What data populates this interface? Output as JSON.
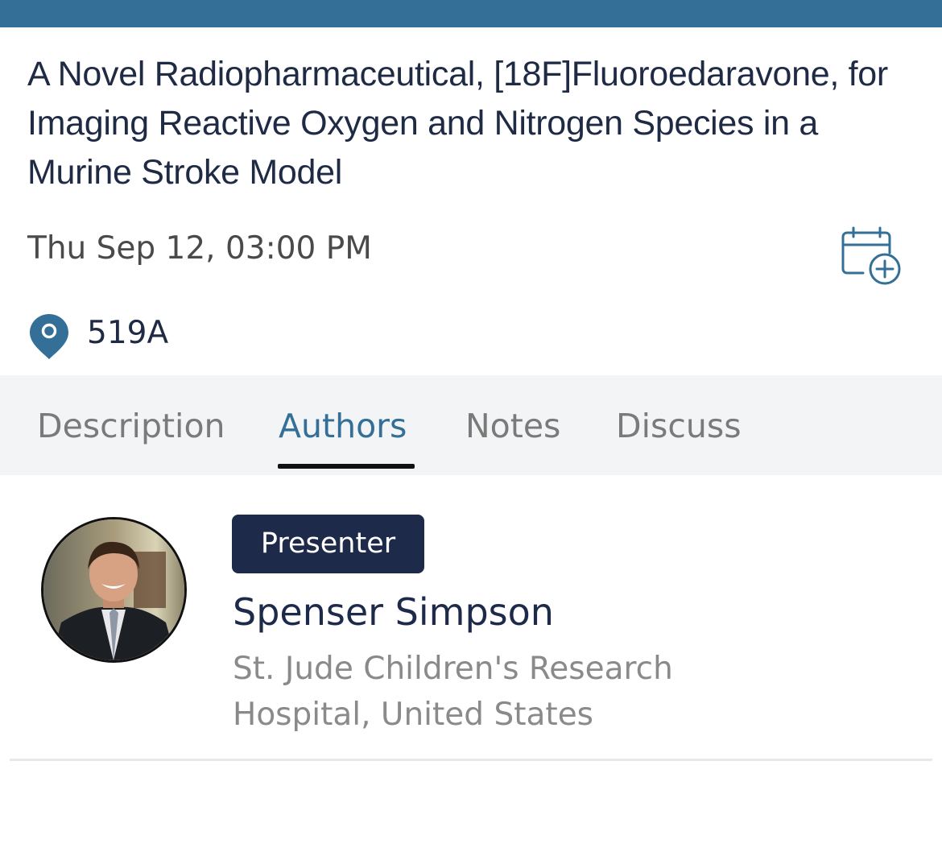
{
  "session": {
    "title": "A Novel Radiopharmaceutical, [18F]Fluoroedaravone, for Imaging Reactive Oxygen and Nitrogen Species in a Murine Stroke Model",
    "datetime": "Thu Sep 12, 03:00 PM",
    "location": "519A"
  },
  "icons": {
    "calendar": "calendar-add-icon",
    "location": "location-pin-icon"
  },
  "colors": {
    "top_bar": "#336f96",
    "accent": "#336f96",
    "badge_bg": "#1e2a4a",
    "tab_bar_bg": "#f3f4f5"
  },
  "tabs": [
    {
      "label": "Description",
      "active": false
    },
    {
      "label": "Authors",
      "active": true
    },
    {
      "label": "Notes",
      "active": false
    },
    {
      "label": "Discuss",
      "active": false
    }
  ],
  "authors": [
    {
      "role": "Presenter",
      "name": "Spenser Simpson",
      "affiliation": "St. Jude Children's Research Hospital, United States"
    }
  ]
}
